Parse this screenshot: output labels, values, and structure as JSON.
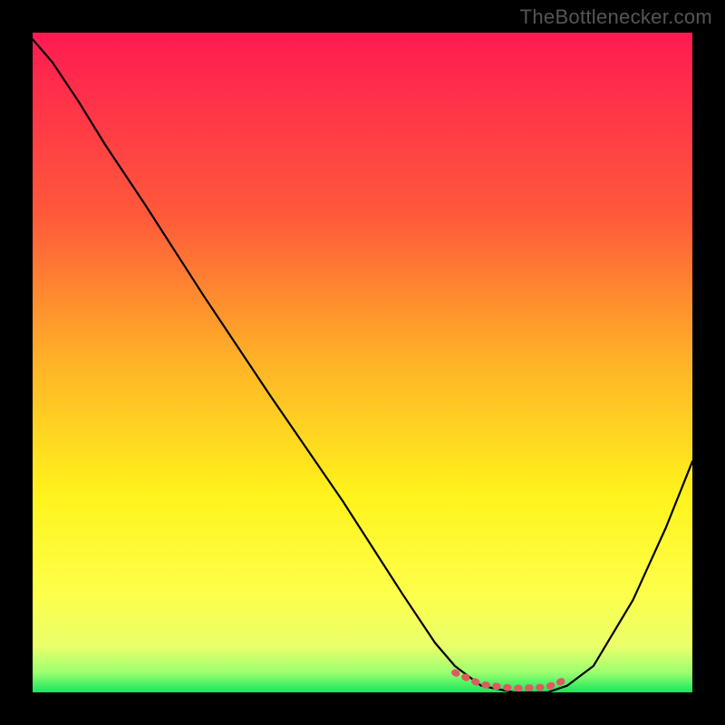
{
  "watermark": "TheBottlenecker.com",
  "chart_data": {
    "type": "line",
    "title": "",
    "xlabel": "",
    "ylabel": "",
    "xlim": [
      0,
      1
    ],
    "ylim": [
      0,
      1
    ],
    "gradient_stops": [
      {
        "offset": 0.0,
        "color": "#ff1a52"
      },
      {
        "offset": 0.28,
        "color": "#ff5a3a"
      },
      {
        "offset": 0.5,
        "color": "#ffb327"
      },
      {
        "offset": 0.7,
        "color": "#fff31c"
      },
      {
        "offset": 0.85,
        "color": "#fdff4a"
      },
      {
        "offset": 0.93,
        "color": "#eaff6a"
      },
      {
        "offset": 0.97,
        "color": "#9cff70"
      },
      {
        "offset": 1.0,
        "color": "#17e65c"
      }
    ],
    "series": [
      {
        "name": "bottleneck-curve",
        "color": "#000000",
        "width": 2.2,
        "x": [
          0.0,
          0.03,
          0.07,
          0.11,
          0.17,
          0.26,
          0.36,
          0.47,
          0.56,
          0.61,
          0.64,
          0.68,
          0.73,
          0.78,
          0.81,
          0.85,
          0.91,
          0.96,
          1.0
        ],
        "y": [
          0.99,
          0.955,
          0.895,
          0.83,
          0.74,
          0.6,
          0.45,
          0.29,
          0.15,
          0.075,
          0.04,
          0.01,
          0.0,
          0.0,
          0.01,
          0.04,
          0.14,
          0.25,
          0.35
        ]
      },
      {
        "name": "low-plateau-marker",
        "color": "#df5a5f",
        "width": 7.5,
        "x": [
          0.64,
          0.68,
          0.73,
          0.78,
          0.81
        ],
        "y": [
          0.03,
          0.012,
          0.006,
          0.008,
          0.02
        ]
      }
    ]
  }
}
